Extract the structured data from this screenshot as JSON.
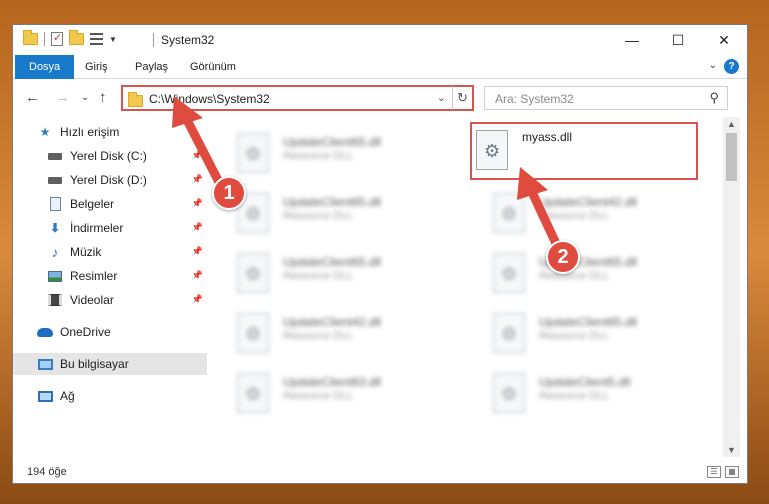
{
  "window": {
    "title": "System32",
    "controls": {
      "minimize": "—",
      "maximize": "☐",
      "close": "✕"
    }
  },
  "ribbon": {
    "tabs": [
      {
        "label": "Dosya",
        "active": true
      },
      {
        "label": "Giriş"
      },
      {
        "label": "Paylaş"
      },
      {
        "label": "Görünüm"
      }
    ],
    "help": "?"
  },
  "address": {
    "path": "C:\\Windows\\System32",
    "search_placeholder": "Ara: System32"
  },
  "sidebar": {
    "items": [
      {
        "label": "Hızlı erişim",
        "icon": "star-icon"
      },
      {
        "label": "Yerel Disk (C:)",
        "icon": "drive-icon",
        "pinned": true
      },
      {
        "label": "Yerel Disk (D:)",
        "icon": "drive-icon",
        "pinned": true
      },
      {
        "label": "Belgeler",
        "icon": "documents-icon",
        "pinned": true
      },
      {
        "label": "İndirmeler",
        "icon": "downloads-icon",
        "pinned": true
      },
      {
        "label": "Müzik",
        "icon": "music-icon",
        "pinned": true
      },
      {
        "label": "Resimler",
        "icon": "pictures-icon",
        "pinned": true
      },
      {
        "label": "Videolar",
        "icon": "videos-icon",
        "pinned": true
      },
      {
        "label": "OneDrive",
        "icon": "cloud-icon"
      },
      {
        "label": "Bu bilgisayar",
        "icon": "computer-icon",
        "selected": true
      },
      {
        "label": "Ağ",
        "icon": "network-icon"
      }
    ]
  },
  "files": [
    {
      "name": "UpdateClient65.dll",
      "type": "Resource DLL"
    },
    {
      "name": "myass.dll",
      "type": "",
      "highlighted": true
    },
    {
      "name": "UpdateClient65.dll",
      "type": "Resource DLL"
    },
    {
      "name": "UpdateClient42.dll",
      "type": "Resource DLL"
    },
    {
      "name": "UpdateClient65.dll",
      "type": "Resource DLL"
    },
    {
      "name": "UpdateClient65.dll",
      "type": "Resource DLL"
    },
    {
      "name": "UpdateClient42.dll",
      "type": "Resource DLL"
    },
    {
      "name": "UpdateClient65.dll",
      "type": "Resource DLL"
    },
    {
      "name": "UpdateClient63.dll",
      "type": "Resource DLL"
    },
    {
      "name": "UpdateClient5.dll",
      "type": "Resource DLL"
    }
  ],
  "status": {
    "count": "194 öğe"
  },
  "annotations": {
    "badge1": "1",
    "badge2": "2",
    "color": "#e04b40"
  }
}
